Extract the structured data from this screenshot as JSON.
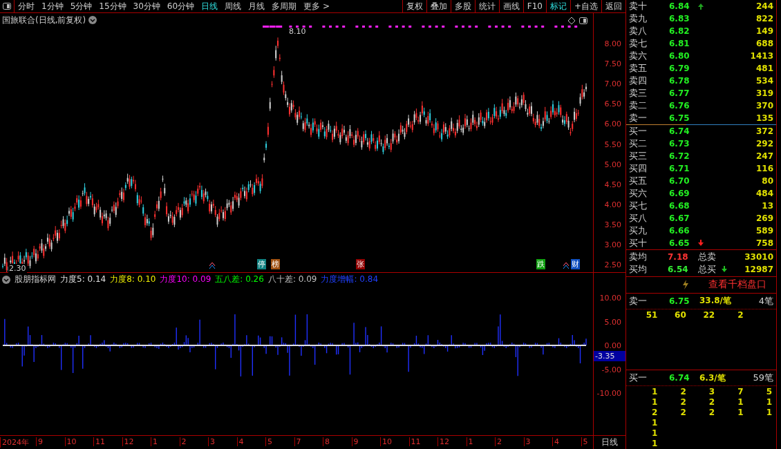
{
  "toolbar": {
    "periods": [
      {
        "label": "分时",
        "selected": false
      },
      {
        "label": "1分钟",
        "selected": false
      },
      {
        "label": "5分钟",
        "selected": false
      },
      {
        "label": "15分钟",
        "selected": false
      },
      {
        "label": "30分钟",
        "selected": false
      },
      {
        "label": "60分钟",
        "selected": false
      },
      {
        "label": "日线",
        "selected": true
      },
      {
        "label": "周线",
        "selected": false
      },
      {
        "label": "月线",
        "selected": false
      },
      {
        "label": "多周期",
        "selected": false
      },
      {
        "label": "更多 >",
        "selected": false
      }
    ],
    "tools": [
      {
        "label": "复权",
        "selected": false
      },
      {
        "label": "叠加",
        "selected": false
      },
      {
        "label": "多股",
        "selected": false
      },
      {
        "label": "统计",
        "selected": false
      },
      {
        "label": "画线",
        "selected": false
      },
      {
        "label": "F10",
        "selected": false
      },
      {
        "label": "标记",
        "selected": true
      },
      {
        "label": "+自选",
        "selected": false
      },
      {
        "label": "返回",
        "selected": false
      }
    ]
  },
  "chart": {
    "title": "国旅联合(日线,前复权)",
    "high_label": "8.10",
    "low_label": "2.30",
    "price_ticks": [
      "8.00",
      "7.50",
      "7.00",
      "6.50",
      "6.00",
      "5.50",
      "5.00",
      "4.50",
      "4.00",
      "3.50",
      "3.00",
      "2.50"
    ],
    "markers": [
      {
        "label": "停",
        "color": "#108080"
      },
      {
        "label": "榜",
        "color": "#a05010"
      },
      {
        "label": "张",
        "color": "#900000"
      },
      {
        "label": "跌",
        "color": "#10a010"
      },
      {
        "label": "财",
        "color": "#1050c0"
      }
    ]
  },
  "indicator": {
    "name": "股朋指标网",
    "params": [
      {
        "label": "力度5: 0.14",
        "color": "#e0e0e0"
      },
      {
        "label": "力度8: 0.10",
        "color": "#f0f000"
      },
      {
        "label": "力度10: 0.09",
        "color": "#ff00ff"
      },
      {
        "label": "五八差: 0.26",
        "color": "#00ff00"
      },
      {
        "label": "八十差: 0.09",
        "color": "#c0c0c0"
      },
      {
        "label": "力度增幅: 0.84",
        "color": "#2040ff"
      }
    ],
    "ticks": [
      "10.00",
      "5.00",
      "0.00",
      "-5.00",
      "-10.00"
    ],
    "current": "-3.35"
  },
  "time_axis": {
    "labels": [
      "2024年",
      "9",
      "10",
      "11",
      "12",
      "1",
      "2",
      "3",
      "4",
      "5",
      "7",
      "8",
      "9",
      "10",
      "11",
      "12",
      "1",
      "2",
      "3",
      "4",
      "5"
    ],
    "period": "日线"
  },
  "order_book": {
    "asks": [
      {
        "label": "卖十",
        "price": "6.84",
        "volume": "244",
        "arrow": true
      },
      {
        "label": "卖九",
        "price": "6.83",
        "volume": "822",
        "arrow": false
      },
      {
        "label": "卖八",
        "price": "6.82",
        "volume": "149",
        "arrow": false
      },
      {
        "label": "卖七",
        "price": "6.81",
        "volume": "688",
        "arrow": false
      },
      {
        "label": "卖六",
        "price": "6.80",
        "volume": "1413",
        "arrow": false
      },
      {
        "label": "卖五",
        "price": "6.79",
        "volume": "481",
        "arrow": false
      },
      {
        "label": "卖四",
        "price": "6.78",
        "volume": "534",
        "arrow": false
      },
      {
        "label": "卖三",
        "price": "6.77",
        "volume": "319",
        "arrow": false
      },
      {
        "label": "卖二",
        "price": "6.76",
        "volume": "370",
        "arrow": false
      },
      {
        "label": "卖一",
        "price": "6.75",
        "volume": "135",
        "arrow": false
      }
    ],
    "bids": [
      {
        "label": "买一",
        "price": "6.74",
        "volume": "372",
        "arrow": false
      },
      {
        "label": "买二",
        "price": "6.73",
        "volume": "292",
        "arrow": false
      },
      {
        "label": "买三",
        "price": "6.72",
        "volume": "247",
        "arrow": false
      },
      {
        "label": "买四",
        "price": "6.71",
        "volume": "116",
        "arrow": false
      },
      {
        "label": "买五",
        "price": "6.70",
        "volume": "80",
        "arrow": false
      },
      {
        "label": "买六",
        "price": "6.69",
        "volume": "484",
        "arrow": false
      },
      {
        "label": "买七",
        "price": "6.68",
        "volume": "13",
        "arrow": false
      },
      {
        "label": "买八",
        "price": "6.67",
        "volume": "269",
        "arrow": false
      },
      {
        "label": "买九",
        "price": "6.66",
        "volume": "589",
        "arrow": false
      },
      {
        "label": "买十",
        "price": "6.65",
        "volume": "758",
        "arrow": true
      }
    ],
    "summary": [
      {
        "label": "卖均",
        "price": "7.18",
        "color": "#ff3333",
        "total_label": "总卖",
        "total": "33010",
        "arrow": false
      },
      {
        "label": "买均",
        "price": "6.54",
        "color": "#33ee33",
        "total_label": "总买",
        "total": "12987",
        "arrow": true
      }
    ],
    "depth_button": "查看千档盘口",
    "queues": [
      {
        "label": "卖一",
        "price": "6.75",
        "avg": "33.8/笔",
        "count": "4笔",
        "orders": [
          [
            "51",
            "60",
            "22",
            "2"
          ]
        ]
      },
      {
        "label": "买一",
        "price": "6.74",
        "avg": "6.3/笔",
        "count": "59笔",
        "orders": [
          [
            "1",
            "2",
            "3",
            "7",
            "5"
          ],
          [
            "1",
            "2",
            "2",
            "1",
            "1"
          ],
          [
            "2",
            "2",
            "2",
            "1",
            "1"
          ],
          [
            "1"
          ],
          [
            "1"
          ],
          [
            "1"
          ]
        ]
      }
    ]
  }
}
